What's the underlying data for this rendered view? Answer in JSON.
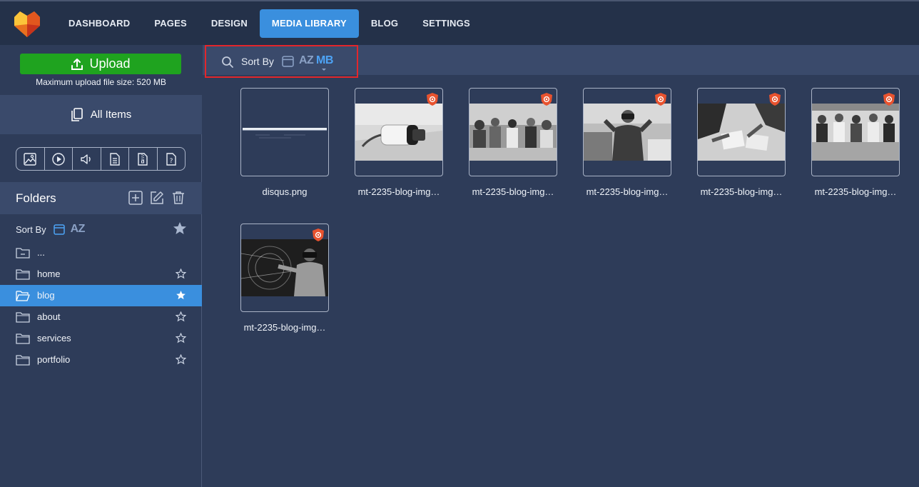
{
  "nav": {
    "items": [
      {
        "label": "DASHBOARD"
      },
      {
        "label": "PAGES"
      },
      {
        "label": "DESIGN"
      },
      {
        "label": "MEDIA LIBRARY"
      },
      {
        "label": "BLOG"
      },
      {
        "label": "SETTINGS"
      }
    ],
    "active": "MEDIA LIBRARY"
  },
  "sidebar": {
    "upload_label": "Upload",
    "upload_note": "Maximum upload file size: 520 MB",
    "all_items_label": "All Items",
    "filters": [
      "image-icon",
      "video-icon",
      "audio-icon",
      "document-icon",
      "archive-icon",
      "unknown-file-icon"
    ],
    "folders_title": "Folders",
    "sort_label": "Sort By",
    "sort_az": "AZ",
    "folders": [
      {
        "name": "...",
        "starred": false,
        "active": false
      },
      {
        "name": "home",
        "starred": false,
        "active": false
      },
      {
        "name": "blog",
        "starred": true,
        "active": true
      },
      {
        "name": "about",
        "starred": false,
        "active": false
      },
      {
        "name": "services",
        "starred": false,
        "active": false
      },
      {
        "name": "portfolio",
        "starred": false,
        "active": false
      }
    ]
  },
  "toolbar": {
    "sort_label": "Sort By",
    "sort_az": "AZ",
    "sort_mb": "MB"
  },
  "media": [
    {
      "name": "disqus.png",
      "kind": "screenshot"
    },
    {
      "name": "mt-2235-blog-img…",
      "kind": "vr-headset"
    },
    {
      "name": "mt-2235-blog-img…",
      "kind": "team-meeting"
    },
    {
      "name": "mt-2235-blog-img…",
      "kind": "vr-man"
    },
    {
      "name": "mt-2235-blog-img…",
      "kind": "desk-papers"
    },
    {
      "name": "mt-2235-blog-img…",
      "kind": "group-seated"
    },
    {
      "name": "mt-2235-blog-img…",
      "kind": "vr-hologram"
    }
  ],
  "colors": {
    "accent": "#3a8fde",
    "upload": "#1fa31f",
    "highlight_box": "#e3262b",
    "badge": "#e8532f"
  }
}
